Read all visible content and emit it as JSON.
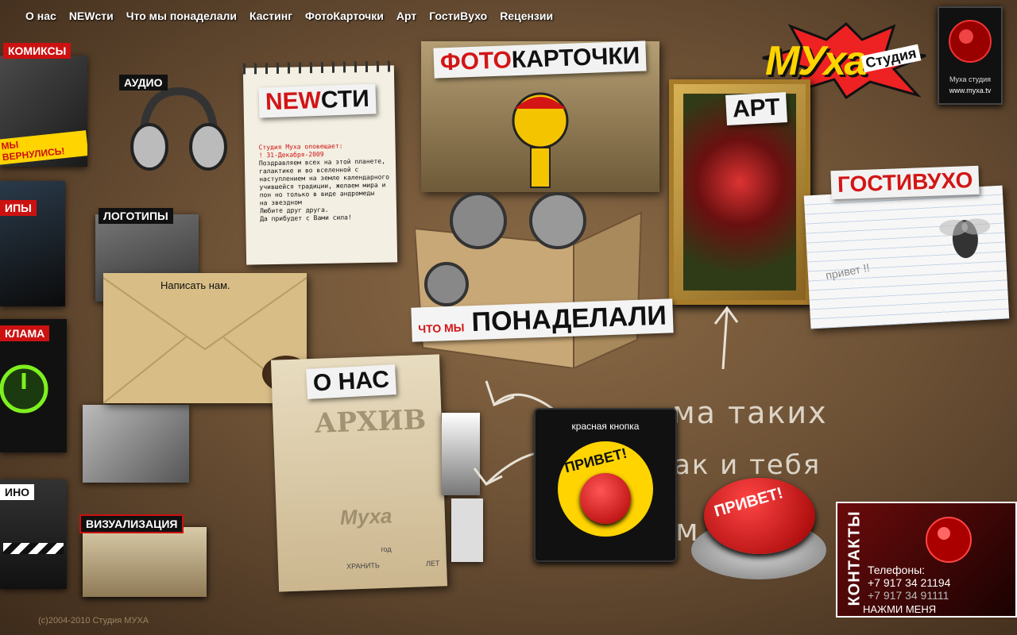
{
  "nav": {
    "items": [
      "О нас",
      "NEWсти",
      "Что мы понаделали",
      "Кастинг",
      "ФотоКарточки",
      "Арт",
      "ГостиВухо",
      "Reцензии"
    ]
  },
  "logo": {
    "brand": "МУха",
    "studio": "Студия",
    "site": "www.myxa.tv",
    "emblem_caption": "Муха студия"
  },
  "left_menu": {
    "comics": "комиксы",
    "audio": "аудио",
    "clips": "ипы",
    "logos": "логотипы",
    "ads": "клама",
    "cinema": "ино",
    "visualization": "визуализация",
    "comics_cover_text": "мы вернулись!"
  },
  "news": {
    "title_red": "NEW",
    "title_black": "сти",
    "lines": [
      "Студия Муха оповещает:",
      "! 31-Декабря-2009",
      "Поздравляем всех на этой планете,",
      "галактике и во вселенной с",
      "наступлением на земле календарного",
      "учившейся традиции, желаем мира и",
      "пон но только в виде андромеды",
      "на звездном",
      "Любите друг друга.",
      "Да прибудет с Вами сила!"
    ]
  },
  "photo": {
    "title_red": "фото",
    "title_black": "карточки"
  },
  "art": {
    "title": "арт"
  },
  "guestbook": {
    "title_red": "гости",
    "title_black": "вухо",
    "note": "привет !!"
  },
  "works": {
    "title_small": "что мы",
    "title_big": "понаделали"
  },
  "envelope": {
    "label": "Написать нам."
  },
  "about": {
    "title": "о нас",
    "stamp": "архив",
    "stamp_logo": "Муха",
    "field_keep": "хранить",
    "field_years": "лет",
    "field_year": "год"
  },
  "chalk": {
    "line1": "ма таких",
    "line2": "ак и тебя",
    "line3": "м"
  },
  "red_button": {
    "caption": "красная кнопка",
    "label": "привет!"
  },
  "big_button": {
    "label": "привет!"
  },
  "contacts": {
    "title": "контакты",
    "phones_label": "Телефоны:",
    "phone1": "+7 917 34 21194",
    "phone2": "+7 917 34 91111",
    "cta": "НАЖМИ МЕНЯ"
  },
  "footer": {
    "copyright": "(c)2004-2010 Студия МУХА"
  },
  "colors": {
    "accent_red": "#d31515",
    "board": "#6e5236",
    "paper": "#f3efe2"
  }
}
